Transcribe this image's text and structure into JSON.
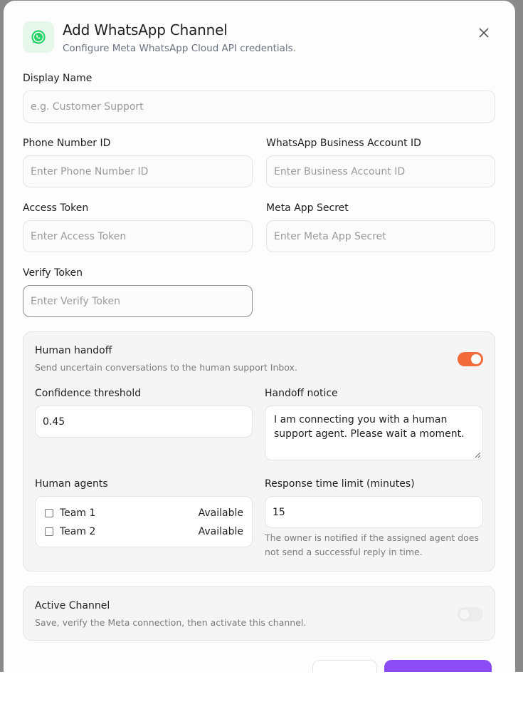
{
  "dialog": {
    "title": "Add WhatsApp Channel",
    "subtitle": "Configure Meta WhatsApp Cloud API credentials.",
    "header_icon": "whatsapp-icon",
    "close_icon": "close-icon"
  },
  "form": {
    "display_name": {
      "label": "Display Name",
      "placeholder": "e.g. Customer Support"
    },
    "phone_number_id": {
      "label": "Phone Number ID",
      "placeholder": "Enter Phone Number ID"
    },
    "business_account_id": {
      "label": "WhatsApp Business Account ID",
      "placeholder": "Enter Business Account ID"
    },
    "access_token": {
      "label": "Access Token",
      "placeholder": "Enter Access Token"
    },
    "meta_app_secret": {
      "label": "Meta App Secret",
      "placeholder": "Enter Meta App Secret"
    },
    "verify_token": {
      "label": "Verify Token",
      "placeholder": "Enter Verify Token"
    }
  },
  "handoff": {
    "title": "Human handoff",
    "description": "Send uncertain conversations to the human support Inbox.",
    "enabled": true,
    "confidence_label": "Confidence threshold",
    "confidence_value": "0.45",
    "notice_label": "Handoff notice",
    "notice_value": "I am connecting you with a human support agent. Please wait a moment.",
    "agents_label": "Human agents",
    "agents": [
      {
        "name": "Team 1",
        "status": "Available",
        "checked": false
      },
      {
        "name": "Team 2",
        "status": "Available",
        "checked": false
      }
    ],
    "response_label": "Response time limit (minutes)",
    "response_value": "15",
    "response_help": "The owner is notified if the assigned agent does not send a successful reply in time."
  },
  "active_channel": {
    "title": "Active Channel",
    "description": "Save, verify the Meta connection, then activate this channel.",
    "enabled": false
  },
  "colors": {
    "accent_toggle": "#f26b3a",
    "primary_button": "#8b4cf6",
    "whatsapp_green": "#25d366"
  }
}
